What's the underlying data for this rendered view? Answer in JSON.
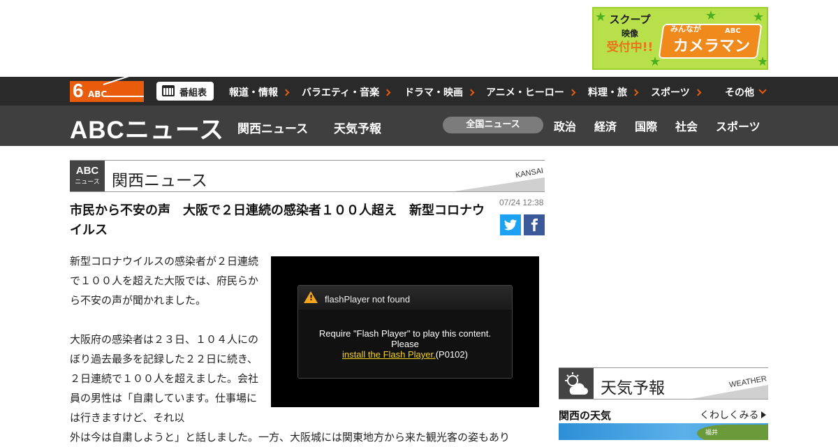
{
  "ad": {
    "scoop1": "スクープ",
    "scoop2": "映像",
    "scoop3": "受付中!!",
    "badge_text": "カメラマン",
    "badge_prefix": "みんなが",
    "badge_abc": "ABC"
  },
  "top_nav": {
    "logo_six": "6",
    "logo_abc": "ABC",
    "schedule_label": "番組表",
    "items": [
      {
        "label": "報道・情報"
      },
      {
        "label": "バラエティ・音楽"
      },
      {
        "label": "ドラマ・映画"
      },
      {
        "label": "アニメ・ヒーロー"
      },
      {
        "label": "料理・旅"
      },
      {
        "label": "スポーツ"
      },
      {
        "label": "その他"
      }
    ]
  },
  "news_nav": {
    "logo": "ABCニュース",
    "left_items": [
      {
        "label": "関西ニュース"
      },
      {
        "label": "天気予報"
      }
    ],
    "active_pill": "全国ニュース",
    "right_items": [
      {
        "label": "政治"
      },
      {
        "label": "経済"
      },
      {
        "label": "国際"
      },
      {
        "label": "社会"
      },
      {
        "label": "スポーツ"
      }
    ]
  },
  "section": {
    "badge_abc": "ABC",
    "badge_news": "ニュース",
    "title": "関西ニュース",
    "english": "KANSAI"
  },
  "article": {
    "headline": "市民から不安の声　大阪で２日連続の感染者１００人超え　新型コロナウイルス",
    "date": "07/24 12:38",
    "paragraphs": [
      "新型コロナウイルスの感染者が２日連続で１００人を超えた大阪では、府民らから不安の声が聞かれました。",
      "大阪府の感染者は２３日、１０４人にのぼり過去最多を記録した２２日に続き、２日連続で１００人を超えました。会社員の男性は「自粛しています。仕事場には行きますけど、それ以"
    ],
    "continuation": "外は今は自粛しようと」と話しました。一方、大阪城には関東地方から来た観光客の姿もあり"
  },
  "video": {
    "title": "flashPlayer not found",
    "line1": "Require \"Flash Player\" to play this content.",
    "line2": "Please",
    "link": "install the Flash Player.",
    "code": "(P0102)"
  },
  "weather": {
    "title": "天気予報",
    "english": "WEATHER",
    "subtitle": "関西の天気",
    "more": "くわしくみる",
    "city": "福井"
  },
  "colors": {
    "accent_orange": "#e85c0c",
    "nav_dark": "#2a2a2a",
    "nav_news": "#3f3f3f",
    "twitter": "#1da1f2",
    "facebook": "#3b5998",
    "flash_link": "#f5d21e"
  }
}
